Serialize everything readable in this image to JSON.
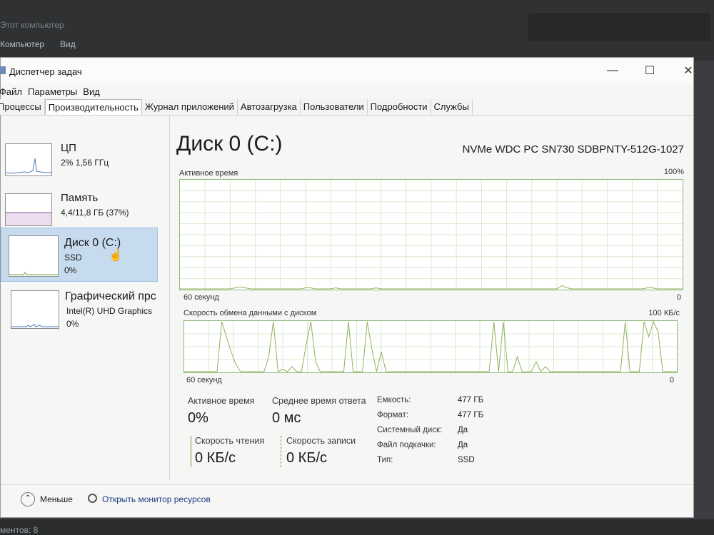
{
  "background": {
    "explorer_title": "Этот компьютер",
    "menu": [
      "Компьютер",
      "Вид"
    ],
    "taskbar_text": "ментов: 8"
  },
  "window": {
    "title": "Диспетчер задач",
    "controls": {
      "minimize": "—",
      "maximize": "☐",
      "close": "✕"
    }
  },
  "menubar": [
    "Файл",
    "Параметры",
    "Вид"
  ],
  "tabs": [
    "Процессы",
    "Производительность",
    "Журнал приложений",
    "Автозагрузка",
    "Пользователи",
    "Подробности",
    "Службы"
  ],
  "active_tab": "Производительность",
  "sidebar": [
    {
      "name": "ЦП",
      "sub": "2%  1,56 ГГц",
      "val": ""
    },
    {
      "name": "Память",
      "sub": "4,4/11,8 ГБ (37%)",
      "val": ""
    },
    {
      "name": "Диск 0 (C:)",
      "sub": "SSD",
      "val": "0%"
    },
    {
      "name": "Графический прс",
      "sub": "Intel(R) UHD Graphics",
      "val": "0%"
    }
  ],
  "main": {
    "title": "Диск 0 (C:)",
    "model": "NVMe WDC PC SN730 SDBPNTY-512G-1027",
    "graph1": {
      "label": "Активное время",
      "max": "100%",
      "time": "60 секунд",
      "min": "0",
      "values": [
        0,
        0,
        0,
        0,
        0,
        0,
        0,
        0,
        0,
        0,
        0,
        1,
        2,
        1,
        0,
        0,
        0,
        0,
        0,
        0,
        0,
        0,
        0,
        0,
        0,
        1,
        1,
        0,
        0,
        0,
        0,
        1,
        0,
        0,
        0,
        0,
        0,
        0,
        0,
        1,
        0,
        0,
        0,
        0,
        0,
        0,
        0,
        0,
        0,
        0,
        0,
        0,
        0,
        0,
        0,
        0,
        0,
        0,
        0,
        0,
        0,
        0,
        0,
        0,
        0,
        0,
        0,
        0,
        0,
        0,
        0,
        0,
        0,
        0,
        0,
        0,
        3,
        1,
        0,
        0,
        0,
        0,
        0,
        0,
        0,
        0,
        0,
        0,
        0,
        0,
        0,
        0,
        0,
        1,
        1,
        0,
        0,
        0,
        0,
        0,
        0
      ]
    },
    "graph2": {
      "label": "Скорость обмена данными с диском",
      "max": "100 КБ/с",
      "time": "60 секунд",
      "min": "0",
      "values": [
        0,
        0,
        0,
        0,
        0,
        0,
        0,
        0,
        100,
        70,
        40,
        15,
        0,
        0,
        0,
        0,
        0,
        0,
        30,
        100,
        0,
        5,
        0,
        10,
        0,
        0,
        55,
        100,
        20,
        0,
        0,
        0,
        0,
        0,
        0,
        100,
        0,
        0,
        0,
        100,
        45,
        0,
        40,
        0,
        0,
        0,
        0,
        0,
        0,
        0,
        0,
        0,
        0,
        0,
        0,
        0,
        0,
        0,
        0,
        0,
        0,
        0,
        0,
        0,
        0,
        0,
        100,
        0,
        100,
        0,
        0,
        30,
        0,
        0,
        0,
        20,
        0,
        10,
        0,
        0,
        0,
        0,
        0,
        0,
        0,
        0,
        0,
        0,
        0,
        0,
        0,
        0,
        0,
        0,
        100,
        0,
        0,
        0,
        100,
        70,
        100,
        80,
        0,
        0,
        0,
        0
      ]
    },
    "stats": {
      "active_label": "Активное время",
      "active_val": "0%",
      "resp_label": "Среднее время ответа",
      "resp_val": "0 мс",
      "read_label": "Скорость чтения",
      "read_val": "0 КБ/с",
      "write_label": "Скорость записи",
      "write_val": "0 КБ/с"
    },
    "props": [
      {
        "key": "Емкость:",
        "val": "477 ГБ"
      },
      {
        "key": "Формат:",
        "val": "477 ГБ"
      },
      {
        "key": "Системный диск:",
        "val": "Да"
      },
      {
        "key": "Файл подкачки:",
        "val": "Да"
      },
      {
        "key": "Тип:",
        "val": "SSD"
      }
    ]
  },
  "footer": {
    "less": "Меньше",
    "monitor": "Открыть монитор ресурсов"
  },
  "colors": {
    "graph_line": "#8db35a",
    "graph_grid": "#dce8d0",
    "read_bar": "#6f9f3c",
    "write_bar": "#6f9f3c",
    "selected": "#c7dbef"
  }
}
